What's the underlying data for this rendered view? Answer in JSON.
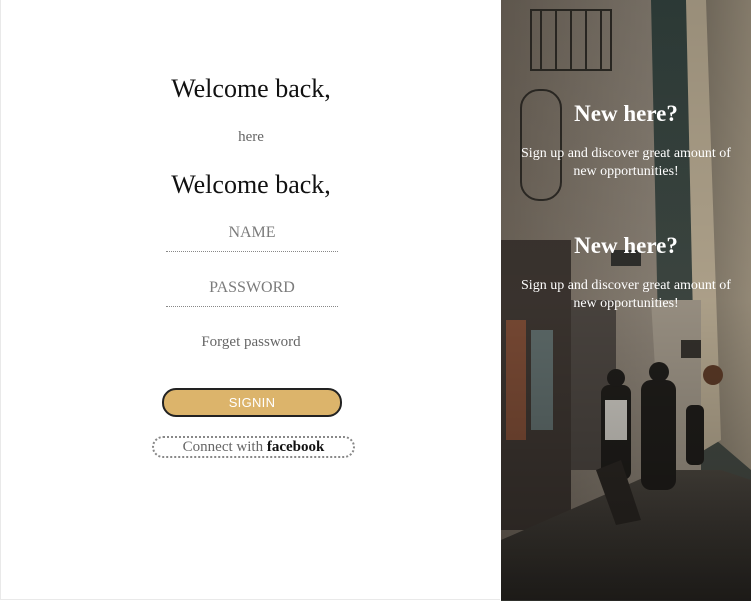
{
  "login": {
    "welcome_top": "Welcome back,",
    "here_text": "here",
    "welcome_second": "Welcome back,",
    "name_placeholder": "NAME",
    "password_placeholder": "PASSWORD",
    "forget_password": "Forget password",
    "signin_label": "SIGNIN",
    "connect_prefix": "Connect with",
    "connect_brand": "facebook",
    "accent_color": "#dcb46b"
  },
  "overlay": {
    "title_1": "New here?",
    "text_1": "Sign up and discover great amount of new opportunities!",
    "title_2": "New here?",
    "text_2": "Sign up and discover great amount of new opportunities!"
  }
}
